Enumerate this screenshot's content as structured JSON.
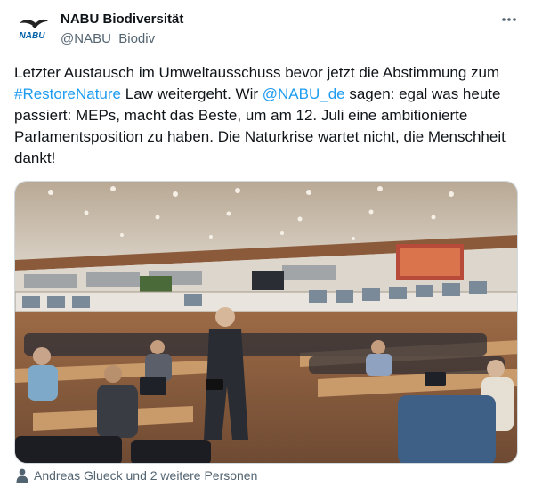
{
  "author": {
    "display_name": "NABU Biodiversität",
    "handle": "@NABU_Biodiv",
    "avatar_text": "NABU"
  },
  "tweet": {
    "text_1": "Letzter Austausch im Umweltausschuss bevor jetzt die Abstimmung zum ",
    "hashtag": "#RestoreNature",
    "text_2": " Law weitergeht. Wir ",
    "mention": "@NABU_de",
    "text_3": " sagen: egal was heute passiert: MEPs, macht das Beste, um am 12. Juli eine ambitionierte Parlamentsposition zu haben. Die Naturkrise wartet nicht, die Menschheit dankt!"
  },
  "tagged_people": "Andreas Glueck und 2 weitere Personen",
  "colors": {
    "link": "#1d9bf0",
    "secondary_text": "#536471",
    "nabu_blue": "#0060a8"
  },
  "icons": {
    "more": "more-icon",
    "person": "person-icon"
  }
}
